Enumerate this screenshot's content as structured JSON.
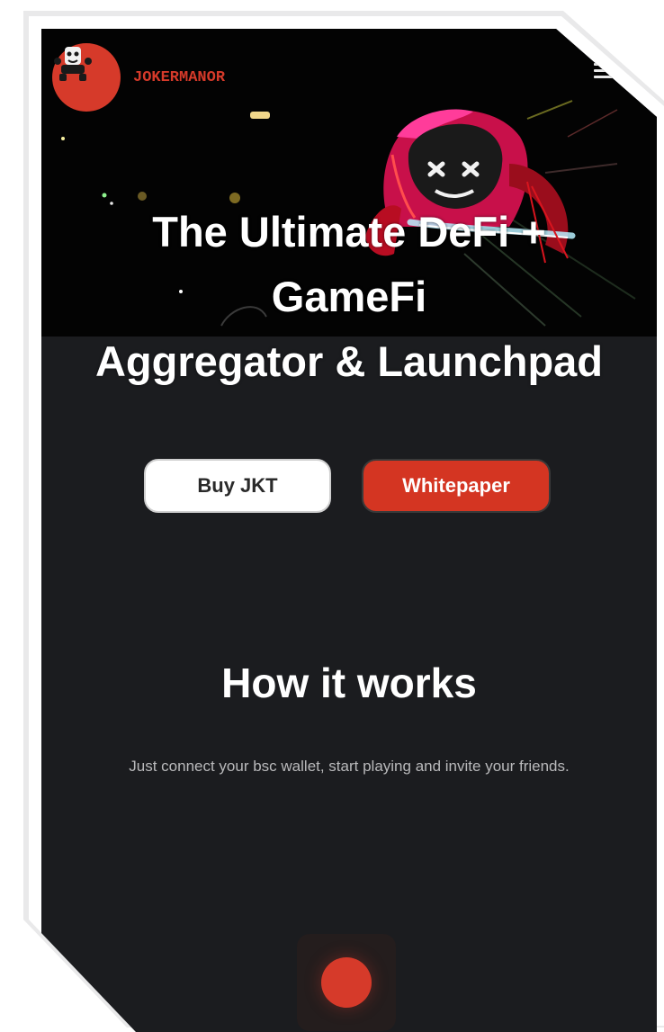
{
  "header": {
    "brand": "JOKERMANOR",
    "logo_icon": "joker-logo-icon",
    "menu_icon": "hamburger-menu-icon"
  },
  "hero": {
    "headline_line1": "The Ultimate DeFi +",
    "headline_line2": "GameFi",
    "headline_line3": "Aggregator & Launchpad"
  },
  "actions": {
    "buy_label": "Buy JKT",
    "whitepaper_label": "Whitepaper"
  },
  "how": {
    "title": "How it works",
    "subtitle": "Just connect your bsc wallet, start playing and invite your friends."
  },
  "colors": {
    "accent": "#d63a2a",
    "background": "#1b1c1f",
    "hero_background": "#030303"
  }
}
